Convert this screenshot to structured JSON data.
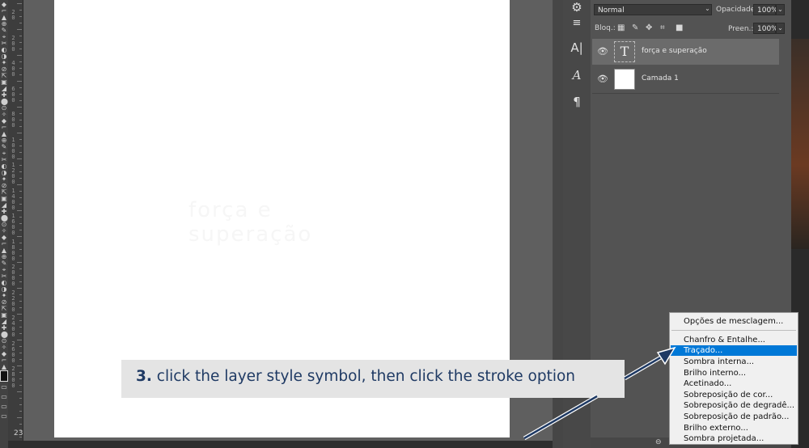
{
  "app": {
    "zoom_indicator": "23"
  },
  "ruler": {
    "labels": [
      "2\n0",
      "2\n0\n0",
      "4\n0\n0",
      "6\n0\n0",
      "8\n0\n0",
      "1\n0\n0\n0",
      "1\n2\n0\n0",
      "1\n4\n0\n0",
      "1\n6\n0\n0",
      "1\n8\n0\n0",
      "2\n0\n0\n0",
      "2\n2\n0\n0",
      "2\n4\n0\n0",
      "2\n6\n0\n0",
      "2\n8\n0\n0"
    ]
  },
  "layers_panel": {
    "blend_mode": "Normal",
    "opacity_label": "Opacidade:",
    "opacity_value": "100%",
    "lock_label": "Bloq.:",
    "fill_label": "Preen.:",
    "fill_value": "100%",
    "layers": [
      {
        "name": "força e superação",
        "thumb_glyph": "T",
        "thumb_icon": "text-layer-icon",
        "selected": true
      },
      {
        "name": "Camada 1",
        "thumb_glyph": "",
        "thumb_icon": "white-fill",
        "selected": false
      }
    ]
  },
  "panel_strip": {
    "buttons": [
      "A|",
      "A",
      "¶"
    ]
  },
  "context_menu": {
    "items": [
      {
        "label": "Opções de mesclagem...",
        "selected": false
      },
      {
        "label": "Chanfro & Entalhe...",
        "selected": false
      },
      {
        "label": "Traçado...",
        "selected": true
      },
      {
        "label": "Sombra interna...",
        "selected": false
      },
      {
        "label": "Brilho interno...",
        "selected": false
      },
      {
        "label": "Acetinado...",
        "selected": false
      },
      {
        "label": "Sobreposição de cor...",
        "selected": false
      },
      {
        "label": "Sobreposição de degradê...",
        "selected": false
      },
      {
        "label": "Sobreposição de padrão...",
        "selected": false
      },
      {
        "label": "Brilho externo...",
        "selected": false
      },
      {
        "label": "Sombra projetada...",
        "selected": false
      }
    ]
  },
  "callout": {
    "number": "3.",
    "text": "click the layer style symbol, then click the stroke option"
  },
  "colors": {
    "accent": "#0078d7",
    "callout_text": "#1f3a64",
    "foreground_swatch": "#111111"
  }
}
